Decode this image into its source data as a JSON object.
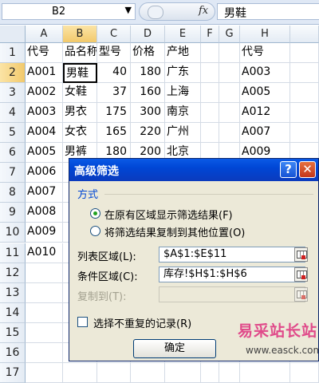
{
  "formula_bar": {
    "name_box": "B2",
    "fx_label": "fx",
    "formula_value": "男鞋"
  },
  "columns": [
    "A",
    "B",
    "C",
    "D",
    "E",
    "F",
    "G",
    "H"
  ],
  "rows": [
    "1",
    "2",
    "3",
    "4",
    "5",
    "6",
    "7",
    "8",
    "9",
    "10",
    "11",
    "12",
    "13",
    "14",
    "15",
    "16",
    "17"
  ],
  "table": [
    [
      "代号",
      "品名称",
      "型号",
      "价格",
      "产地"
    ],
    [
      "A001",
      "男鞋",
      "40",
      "180",
      "广东"
    ],
    [
      "A002",
      "女鞋",
      "37",
      "160",
      "上海"
    ],
    [
      "A003",
      "男衣",
      "175",
      "300",
      "南京"
    ],
    [
      "A004",
      "女衣",
      "165",
      "220",
      "广州"
    ],
    [
      "A005",
      "男裤",
      "180",
      "200",
      "北京"
    ],
    [
      "A006",
      "",
      "",
      "",
      ""
    ],
    [
      "A007",
      "",
      "",
      "",
      ""
    ],
    [
      "A008",
      "",
      "",
      "",
      ""
    ],
    [
      "A009",
      "",
      "",
      "",
      ""
    ],
    [
      "A010",
      "",
      "",
      "",
      ""
    ]
  ],
  "criteria_column": [
    "代号",
    "A003",
    "A005",
    "A012",
    "A007",
    "A009"
  ],
  "dialog": {
    "title": "高级筛选",
    "help_label": "?",
    "close_label": "✕",
    "method_label": "方式",
    "option_filter_in_place": "在原有区域显示筛选结果(F)",
    "option_copy_to": "将筛选结果复制到其他位置(O)",
    "list_range_label": "列表区域(L):",
    "list_range_value": "$A$1:$E$11",
    "criteria_range_label": "条件区域(C):",
    "criteria_range_value": "库存!$H$1:$H$6",
    "copy_to_label": "复制到(T):",
    "copy_to_value": "",
    "unique_label": "选择不重复的记录(R)",
    "unique_checked": false,
    "ok_label": "确定"
  },
  "watermark": {
    "title": "易采站长站",
    "url": "www.easck.com"
  }
}
